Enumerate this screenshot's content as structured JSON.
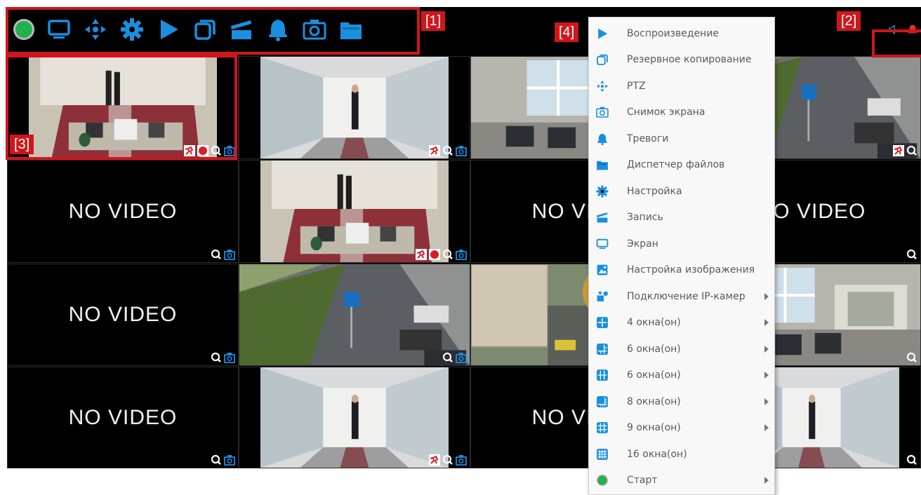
{
  "callouts": {
    "c1": "[1]",
    "c2": "[2]",
    "c3": "[3]",
    "c4": "[4]"
  },
  "toolbar": {
    "icons": [
      "status-dot-icon",
      "monitor-icon",
      "ptz-arrows-icon",
      "gear-icon",
      "play-icon",
      "backup-windows-icon",
      "clapper-icon",
      "bell-icon",
      "camera-icon",
      "folder-icon"
    ],
    "accent": "#1a8fe0",
    "status_color": "#22b14c"
  },
  "right_toolbar": {
    "icons": [
      "speaker-icon",
      "alarm-icon"
    ]
  },
  "grid": {
    "no_video_text": "NO VIDEO",
    "tiles": [
      {
        "row": 0,
        "col": 0,
        "type": "video",
        "scene": "reception",
        "overlay": [
          "motion",
          "rec",
          "zoom",
          "snapshot"
        ]
      },
      {
        "row": 0,
        "col": 1,
        "type": "video",
        "scene": "corridor",
        "overlay": [
          "motion",
          "zoom",
          "snapshot"
        ]
      },
      {
        "row": 0,
        "col": 2,
        "type": "video",
        "scene": "office",
        "overlay": []
      },
      {
        "row": 0,
        "col": 3,
        "type": "video",
        "scene": "street",
        "overlay": [
          "motion",
          "zoom"
        ]
      },
      {
        "row": 1,
        "col": 0,
        "type": "novideo",
        "overlay": [
          "zoom",
          "snapshot"
        ]
      },
      {
        "row": 1,
        "col": 1,
        "type": "video",
        "scene": "reception",
        "overlay": [
          "motion",
          "rec",
          "zoom",
          "snapshot"
        ]
      },
      {
        "row": 1,
        "col": 2,
        "type": "novideo",
        "overlay": []
      },
      {
        "row": 1,
        "col": 3,
        "type": "novideo",
        "overlay": [
          "zoom"
        ]
      },
      {
        "row": 2,
        "col": 0,
        "type": "novideo",
        "overlay": [
          "zoom",
          "snapshot"
        ]
      },
      {
        "row": 2,
        "col": 1,
        "type": "video",
        "scene": "street",
        "overlay": [
          "zoom",
          "snapshot"
        ]
      },
      {
        "row": 2,
        "col": 2,
        "type": "video",
        "scene": "courtyard",
        "overlay": []
      },
      {
        "row": 2,
        "col": 3,
        "type": "video",
        "scene": "office",
        "overlay": [
          "zoom"
        ]
      },
      {
        "row": 3,
        "col": 0,
        "type": "novideo",
        "overlay": [
          "zoom",
          "snapshot"
        ]
      },
      {
        "row": 3,
        "col": 1,
        "type": "video",
        "scene": "corridor",
        "overlay": [
          "motion",
          "zoom",
          "snapshot"
        ]
      },
      {
        "row": 3,
        "col": 2,
        "type": "novideo",
        "overlay": []
      },
      {
        "row": 3,
        "col": 3,
        "type": "video",
        "scene": "corridor",
        "overlay": [
          "zoom"
        ]
      }
    ]
  },
  "context_menu": {
    "items": [
      {
        "label": "Воспроизведение",
        "icon": "play-icon",
        "submenu": false
      },
      {
        "label": "Резервное копирование",
        "icon": "backup-icon",
        "submenu": false
      },
      {
        "label": "PTZ",
        "icon": "ptz-icon",
        "submenu": false
      },
      {
        "label": "Снимок экрана",
        "icon": "camera-icon",
        "submenu": false
      },
      {
        "label": "Тревоги",
        "icon": "bell-icon",
        "submenu": false
      },
      {
        "label": "Диспетчер файлов",
        "icon": "folder-icon",
        "submenu": false
      },
      {
        "label": "Настройка",
        "icon": "gear-icon",
        "submenu": false
      },
      {
        "label": "Запись",
        "icon": "clapper-icon",
        "submenu": false
      },
      {
        "label": "Экран",
        "icon": "monitor-icon",
        "submenu": false
      },
      {
        "label": "Настройка изображения",
        "icon": "image-icon",
        "submenu": false
      },
      {
        "label": "Подключение IP-камер",
        "icon": "ip-camera-icon",
        "submenu": true
      },
      {
        "label": "4 окна(он)",
        "icon": "layout-4-icon",
        "submenu": true
      },
      {
        "label": "6 окна(он)",
        "icon": "layout-6a-icon",
        "submenu": true
      },
      {
        "label": "6 окна(он)",
        "icon": "layout-6b-icon",
        "submenu": true
      },
      {
        "label": "8 окна(он)",
        "icon": "layout-8-icon",
        "submenu": true
      },
      {
        "label": "9 окна(он)",
        "icon": "layout-9-icon",
        "submenu": true
      },
      {
        "label": "16 окна(он)",
        "icon": "layout-16-icon",
        "submenu": false
      },
      {
        "label": "Старт",
        "icon": "start-dot-icon",
        "submenu": true
      }
    ]
  }
}
